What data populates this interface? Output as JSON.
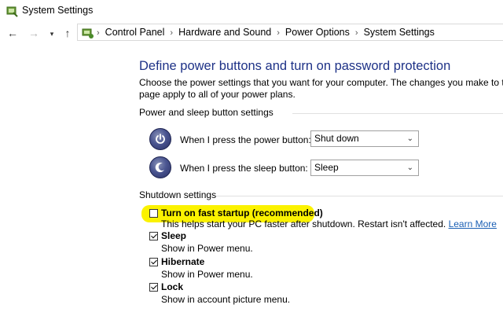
{
  "window": {
    "title": "System Settings"
  },
  "navigation": {
    "back_icon": "back-arrow-icon",
    "forward_icon": "forward-arrow-icon",
    "recent_icon": "chevron-down-icon",
    "up_icon": "up-arrow-icon",
    "breadcrumbs": [
      "Control Panel",
      "Hardware and Sound",
      "Power Options",
      "System Settings"
    ],
    "separator": "›"
  },
  "main": {
    "title": "Define power buttons and turn on password protection",
    "description_line1": "Choose the power settings that you want for your computer. The changes you make to the setti",
    "description_line2": "page apply to all of your power plans.",
    "power_section": {
      "heading": "Power and sleep button settings",
      "power_button": {
        "label": "When I press the power button:",
        "value": "Shut down",
        "icon": "power-icon"
      },
      "sleep_button": {
        "label": "When I press the sleep button:",
        "value": "Sleep",
        "icon": "sleep-icon"
      }
    },
    "shutdown_section": {
      "heading": "Shutdown settings",
      "highlight_color": "#fbf200",
      "options": [
        {
          "label": "Turn on fast startup (recommended)",
          "checked": false,
          "description": "This helps start your PC faster after shutdown. Restart isn't affected.",
          "link": "Learn More"
        },
        {
          "label": "Sleep",
          "checked": true,
          "description": "Show in Power menu."
        },
        {
          "label": "Hibernate",
          "checked": true,
          "description": "Show in Power menu."
        },
        {
          "label": "Lock",
          "checked": true,
          "description": "Show in account picture menu."
        }
      ]
    }
  },
  "colors": {
    "title_blue": "#1e3287",
    "link_blue": "#1a5fb4"
  }
}
